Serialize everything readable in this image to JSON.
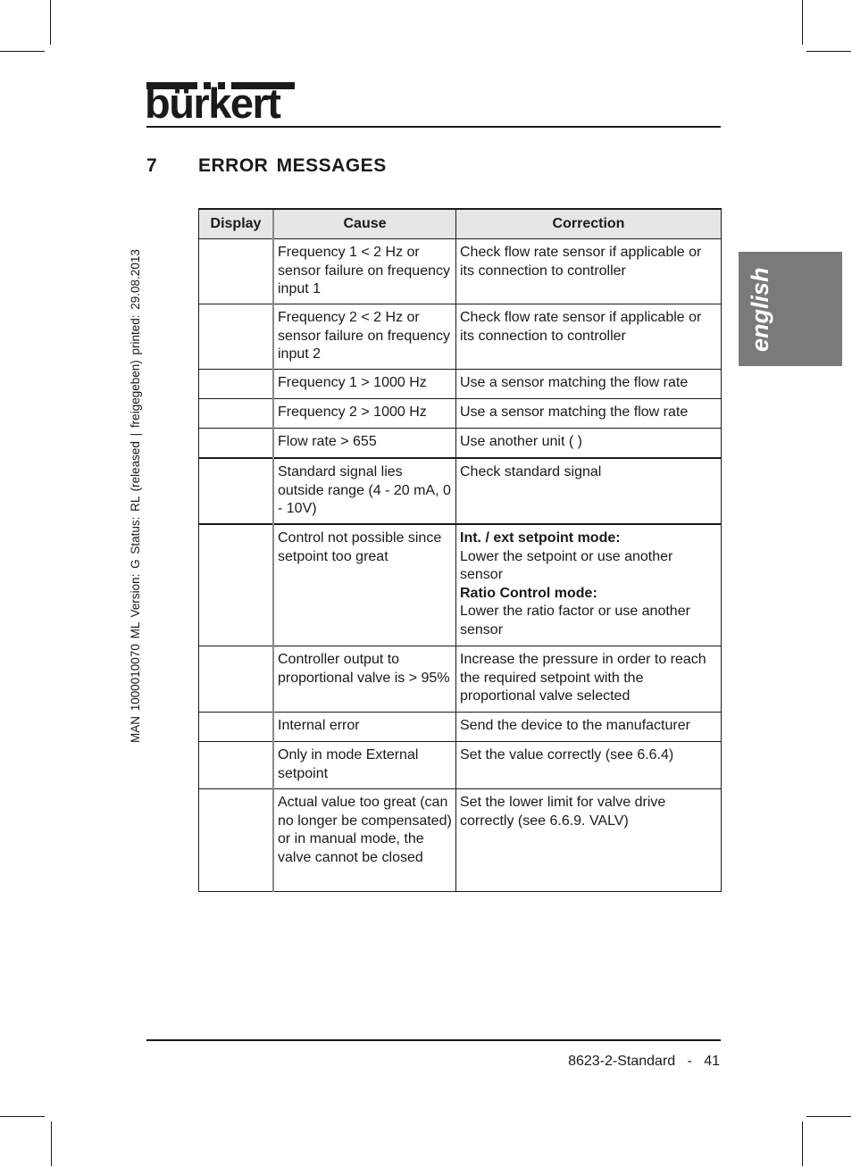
{
  "brand": {
    "logo_text": "bürkert"
  },
  "section": {
    "number": "7",
    "title": "ERROR MESSAGES"
  },
  "side_meta": "MAN  1000010070  ML  Version: G  Status: RL (released | freigegeben)  printed: 29.08.2013",
  "language_tab": "english",
  "table": {
    "headers": [
      "Display",
      "Cause",
      "Correction"
    ],
    "rows": [
      {
        "display": "",
        "cause": "Frequency 1 < 2 Hz or sensor failure on frequency input 1",
        "correction": [
          {
            "text": "Check flow rate sensor if applicable or its connection to controller",
            "bold": false
          }
        ]
      },
      {
        "display": "",
        "cause": "Frequency 2 < 2 Hz or sensor failure on frequency input 2",
        "correction": [
          {
            "text": "Check flow rate sensor if applicable or its connection to controller",
            "bold": false
          }
        ]
      },
      {
        "display": "",
        "cause": "Frequency 1 > 1000 Hz",
        "correction": [
          {
            "text": "Use a sensor matching the flow rate",
            "bold": false
          }
        ]
      },
      {
        "display": "",
        "cause": "Frequency 2 > 1000 Hz",
        "correction": [
          {
            "text": "Use a sensor matching the flow rate",
            "bold": false
          }
        ]
      },
      {
        "display": "",
        "cause": "Flow rate > 655",
        "correction": [
          {
            "text": "Use another unit (      )",
            "bold": false
          }
        ]
      },
      {
        "display": "",
        "cause": "Standard signal lies outside range (4 - 20 mA, 0 - 10V)",
        "correction": [
          {
            "text": "Check standard signal",
            "bold": false
          }
        ]
      },
      {
        "display": "",
        "cause": "Control not possible since setpoint too great",
        "correction": [
          {
            "text": "Int. / ext setpoint mode:",
            "bold": true
          },
          {
            "text": "Lower the setpoint or use another sensor",
            "bold": false
          },
          {
            "text": "Ratio Control mode:",
            "bold": true
          },
          {
            "text": "Lower the ratio factor or use another sensor",
            "bold": false
          }
        ]
      },
      {
        "display": "",
        "cause": "Controller output to proportional valve is > 95%",
        "correction": [
          {
            "text": "Increase the pressure in order to reach the required setpoint with the proportional valve selected",
            "bold": false
          }
        ]
      },
      {
        "display": "",
        "cause": "Internal error",
        "correction": [
          {
            "text": "Send the device to the manufacturer",
            "bold": false
          }
        ]
      },
      {
        "display": "",
        "cause": "Only in mode External setpoint",
        "correction": [
          {
            "text": "Set the value correctly (see 6.6.4)",
            "bold": false
          }
        ]
      },
      {
        "display": "",
        "cause": "Actual value too great (can no longer be compensated) or in manual mode, the valve cannot be closed",
        "correction": [
          {
            "text": "Set the lower limit for valve drive correctly (see 6.6.9. VALV)",
            "bold": false
          }
        ]
      }
    ]
  },
  "footer": {
    "doc_name": "8623-2-Standard",
    "separator": "-",
    "page_number": "41"
  }
}
